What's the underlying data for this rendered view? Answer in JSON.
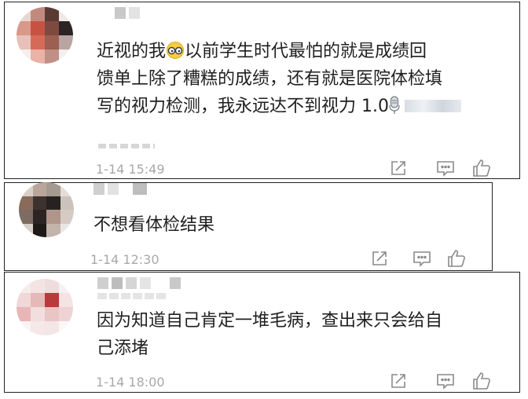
{
  "comments": [
    {
      "text_before_emoji": "近视的我",
      "emoji": "glasses-emoji",
      "text_after_emoji": "以前学生时代最怕的就是成绩回",
      "line2": "馈单上除了糟糕的成绩，还有就是医院体检填",
      "line3": "写的视力检测，我永远达不到视力 1.0",
      "trailing_icon": "microphone-icon",
      "time": "1-14 15:49"
    },
    {
      "text": "不想看体检结果",
      "time": "1-14 12:30"
    },
    {
      "line1": "因为知道自己肯定一堆毛病，查出来只会给自",
      "line2": "己添堵",
      "time": "1-14 18:00"
    }
  ],
  "action_icons": [
    "share-icon",
    "comment-icon",
    "like-icon"
  ],
  "colors": {
    "text": "#1f1f1f",
    "meta": "#a8a8a8",
    "icon": "#8a8a8a",
    "border": "#222222"
  }
}
